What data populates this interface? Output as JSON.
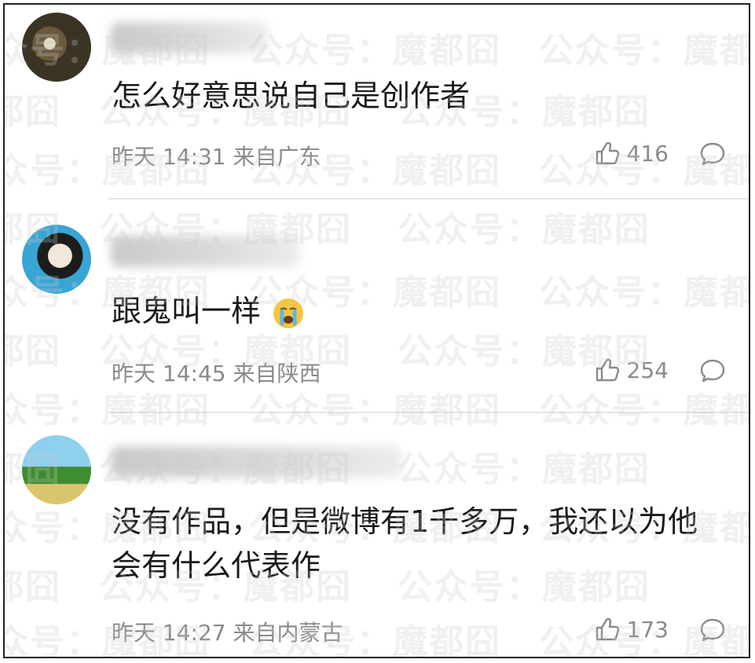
{
  "watermark": "公众号：魔都囧",
  "comments": [
    {
      "username": "",
      "text": "怎么好意思说自己是创作者",
      "time": "昨天 14:31 来自广东",
      "likes": "416",
      "emoji": ""
    },
    {
      "username": "",
      "text": "跟鬼叫一样",
      "time": "昨天 14:45 来自陕西",
      "likes": "254",
      "emoji": "crying-face-emoji"
    },
    {
      "username": "",
      "text": "没有作品，但是微博有1千多万，我还以为他会有什么代表作",
      "time": "昨天 14:27 来自内蒙古",
      "likes": "173",
      "emoji": ""
    }
  ]
}
